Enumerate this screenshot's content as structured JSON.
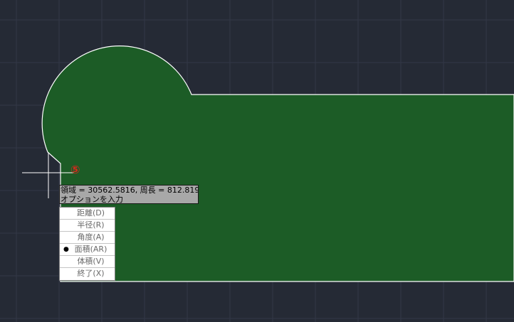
{
  "colors": {
    "background": "#252a35",
    "grid": "#323846",
    "region_fill": "#1c5c26",
    "region_outline": "#ffffff",
    "crosshair": "#ffffff",
    "marker": "#d6281c"
  },
  "marker": {
    "symbol": "⑤"
  },
  "tooltip": {
    "line1": "領域 = 30562.5816, 周長 = 812.8193",
    "line2": "オプションを入力"
  },
  "menu": {
    "items": [
      {
        "label": "距離(D)",
        "selected": false
      },
      {
        "label": "半径(R)",
        "selected": false
      },
      {
        "label": "角度(A)",
        "selected": false
      },
      {
        "label": "面積(AR)",
        "selected": true
      },
      {
        "label": "体積(V)",
        "selected": false
      },
      {
        "label": "終了(X)",
        "selected": false
      }
    ],
    "bullet": "●"
  }
}
